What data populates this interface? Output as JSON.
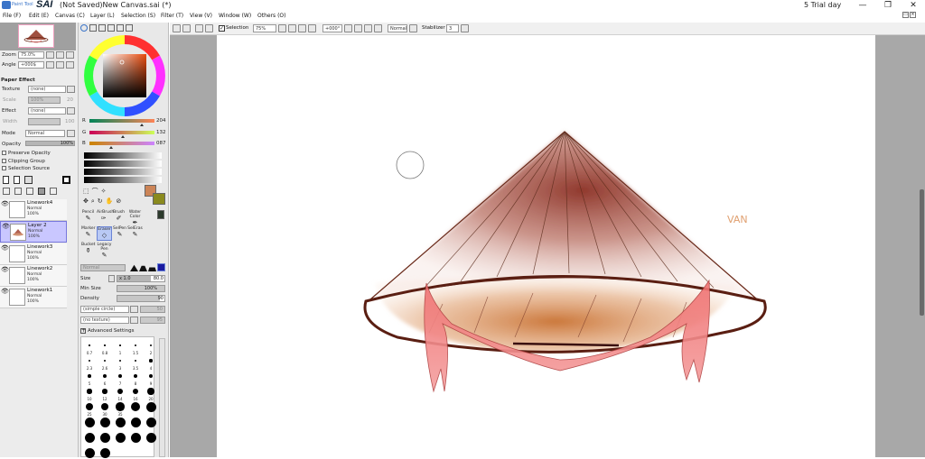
{
  "app": {
    "logo_text": "Paint Tool",
    "name": "SAI",
    "document_title": "(Not Saved)New Canvas.sai (*)",
    "trial": "5 Trial day"
  },
  "window_controls": {
    "minimize": "—",
    "maximize": "❐",
    "close": "✕"
  },
  "menu": [
    "File (F)",
    "Edit (E)",
    "Canvas (C)",
    "Layer (L)",
    "Selection (S)",
    "Filter (T)",
    "View (V)",
    "Window (W)",
    "Others (O)"
  ],
  "toolbar": {
    "selection_label": "Selection",
    "zoom": "75%",
    "rotation": "+000°",
    "blend": "Normal",
    "stabilizer_label": "Stabilizer",
    "stabilizer_value": "3"
  },
  "navigator": {
    "zoom_label": "Zoom",
    "zoom_value": "75.0%",
    "angle_label": "Angle",
    "angle_value": "+000$"
  },
  "paper_effect": {
    "header": "Paper Effect",
    "texture_label": "Texture",
    "texture_value": "(none)",
    "scale_label": "Scale",
    "scale_value": "100%",
    "scale_num": "20",
    "effect_label": "Effect",
    "effect_value": "(none)",
    "width_label": "Width",
    "width_num": "100"
  },
  "layer_props": {
    "mode_label": "Mode",
    "mode_value": "Normal",
    "opacity_label": "Opacity",
    "opacity_value": "100%",
    "preserve_opacity": "Preserve Opacity",
    "clipping_group": "Clipping Group",
    "selection_source": "Selection Source"
  },
  "layers": [
    {
      "name": "Linework4",
      "mode": "Normal",
      "opacity": "100%",
      "selected": false
    },
    {
      "name": "Layer 2",
      "mode": "Normal",
      "opacity": "100%",
      "selected": true
    },
    {
      "name": "Linework3",
      "mode": "Normal",
      "opacity": "100%",
      "selected": false
    },
    {
      "name": "Linework2",
      "mode": "Normal",
      "opacity": "100%",
      "selected": false
    },
    {
      "name": "Linework1",
      "mode": "Normal",
      "opacity": "100%",
      "selected": false
    }
  ],
  "color": {
    "r_label": "R",
    "r_value": "204",
    "g_label": "G",
    "g_value": "132",
    "b_label": "B",
    "b_value": "087",
    "r_level": 0.8,
    "g_level": 0.52,
    "b_level": 0.34,
    "primary": "#cc8457",
    "secondary": "#8a8a1e",
    "wheel_selected": "#b3440f"
  },
  "tools": [
    {
      "name": "Pencil",
      "icon": "✎",
      "selected": false
    },
    {
      "name": "AirBrush",
      "icon": "✑",
      "selected": false
    },
    {
      "name": "Brush",
      "icon": "✐",
      "selected": false
    },
    {
      "name": "Water Color",
      "icon": "✒",
      "selected": false
    },
    {
      "name": "Marker",
      "icon": "✎",
      "selected": false
    },
    {
      "name": "Eraser",
      "icon": "◇",
      "selected": true
    },
    {
      "name": "SelPen",
      "icon": "✎",
      "selected": false
    },
    {
      "name": "SelEras",
      "icon": "✎",
      "selected": false
    },
    {
      "name": "Bucket",
      "icon": "⚱",
      "selected": false
    },
    {
      "name": "Legacy Pen",
      "icon": "✎",
      "selected": false
    }
  ],
  "brush": {
    "mode_value": "Normal",
    "size_label": "Size",
    "size_mult": "x 1.0",
    "size_value": "80.0",
    "min_size_label": "Min Size",
    "min_size_value": "100%",
    "density_label": "Density",
    "density_value": "90",
    "shape_value": "(simple circle)",
    "shape_num": "50",
    "texture_value": "(no texture)",
    "texture_num": "95",
    "advanced": "Advanced Settings"
  },
  "brush_sizes": [
    "0.7",
    "0.8",
    "1",
    "1.5",
    "2",
    "2.3",
    "2.6",
    "3",
    "3.5",
    "4",
    "5",
    "6",
    "7",
    "8",
    "9",
    "10",
    "12",
    "14",
    "16",
    "20",
    "25",
    "30",
    "35",
    "40",
    "50",
    "60",
    "70",
    "80",
    "100",
    "120",
    "160",
    "200",
    "250",
    "300",
    "350",
    "400",
    "500"
  ],
  "canvas": {
    "signature": "VAN"
  }
}
